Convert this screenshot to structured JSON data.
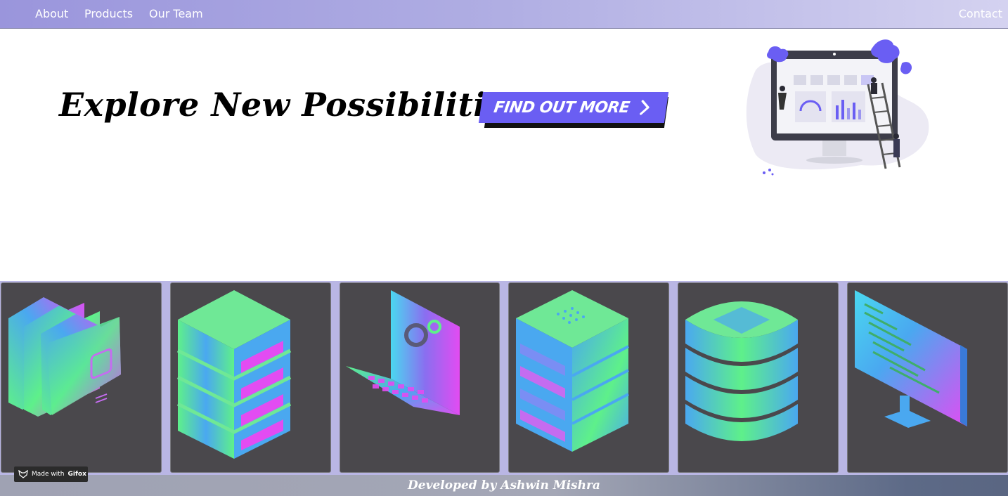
{
  "nav": {
    "about": "About",
    "products": "Products",
    "our_team": "Our Team",
    "contact": "Contact"
  },
  "hero": {
    "title": "Explore New Possibilities",
    "cta_label": "FIND OUT MORE"
  },
  "cards": [
    {
      "icon": "folders-icon"
    },
    {
      "icon": "server-rack-icon"
    },
    {
      "icon": "laptop-settings-icon"
    },
    {
      "icon": "database-server-icon"
    },
    {
      "icon": "database-stack-icon"
    },
    {
      "icon": "code-monitor-icon"
    }
  ],
  "badge": {
    "prefix": "Made with",
    "brand": "Gifox"
  },
  "footer": {
    "credit": "Developed by Ashwin Mishra"
  },
  "colors": {
    "accent": "#6a5ef3",
    "card_bg": "#4a484c",
    "gradient_blue": "#4aa8f0",
    "gradient_green": "#5ef08a",
    "gradient_pink": "#e24cf2"
  }
}
